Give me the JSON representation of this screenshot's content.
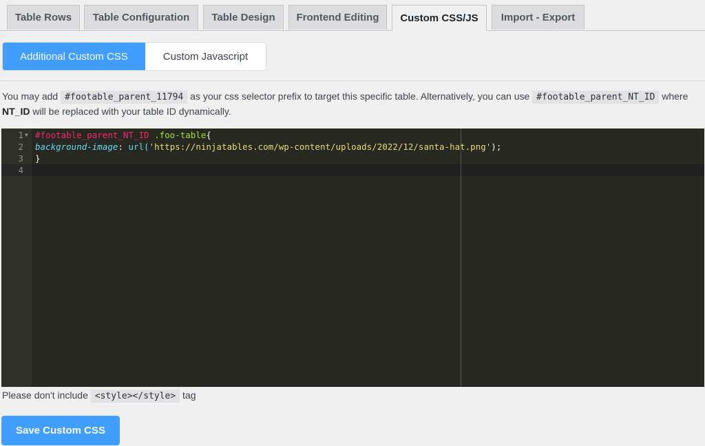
{
  "tabs": [
    {
      "label": "Table Rows"
    },
    {
      "label": "Table Configuration"
    },
    {
      "label": "Table Design"
    },
    {
      "label": "Frontend Editing"
    },
    {
      "label": "Custom CSS/JS",
      "active": true
    },
    {
      "label": "Import - Export"
    }
  ],
  "subtabs": [
    {
      "label": "Additional Custom CSS",
      "active": true
    },
    {
      "label": "Custom Javascript"
    }
  ],
  "info": {
    "part1": "You may add ",
    "selector": "#footable_parent_11794",
    "part2": " as your css selector prefix to target this specific table. Alternatively, you can use ",
    "dynamic_selector": "#footable_parent_NT_ID",
    "part3": " where ",
    "bold": "NT_ID",
    "part4": " will be replaced with your table ID dynamically."
  },
  "editor": {
    "line_numbers": [
      "1",
      "2",
      "3",
      "4"
    ],
    "code": {
      "l1_selector": "#footable_parent_NT_ID",
      "l1_class": " .foo-table",
      "l1_brace": "{",
      "l2_prop": "background-image",
      "l2_colon": ": ",
      "l2_fn": "url(",
      "l2_str": "'https://ninjatables.com/wp-content/uploads/2022/12/santa-hat.png'",
      "l2_end": ");",
      "l3": "}"
    }
  },
  "note": {
    "before": "Please don't include ",
    "code": "<style></style>",
    "after": " tag"
  },
  "save_label": "Save Custom CSS",
  "colors": {
    "accent": "#409eff",
    "editor_bg": "#272822"
  }
}
